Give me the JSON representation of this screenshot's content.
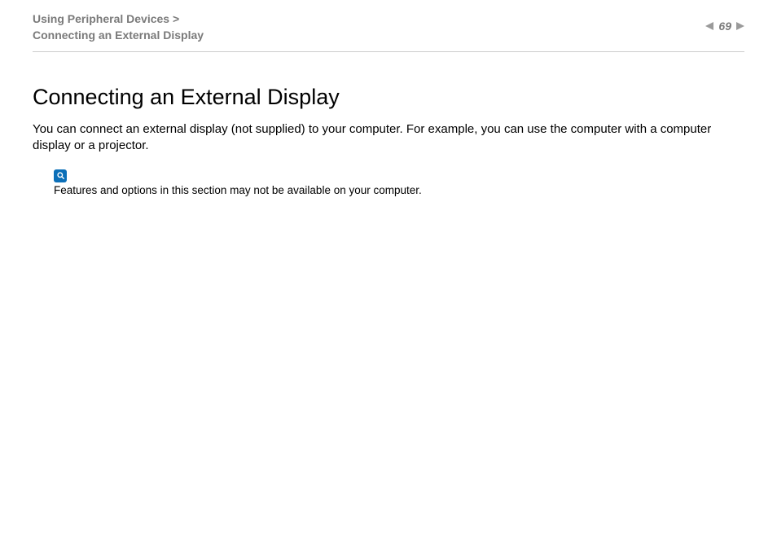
{
  "header": {
    "breadcrumb_section": "Using Peripheral Devices",
    "breadcrumb_separator": ">",
    "breadcrumb_page": "Connecting an External Display",
    "page_number": "69"
  },
  "content": {
    "title": "Connecting an External Display",
    "intro": "You can connect an external display (not supplied) to your computer. For example, you can use the computer with a computer display or a projector.",
    "note": "Features and options in this section may not be available on your computer."
  }
}
